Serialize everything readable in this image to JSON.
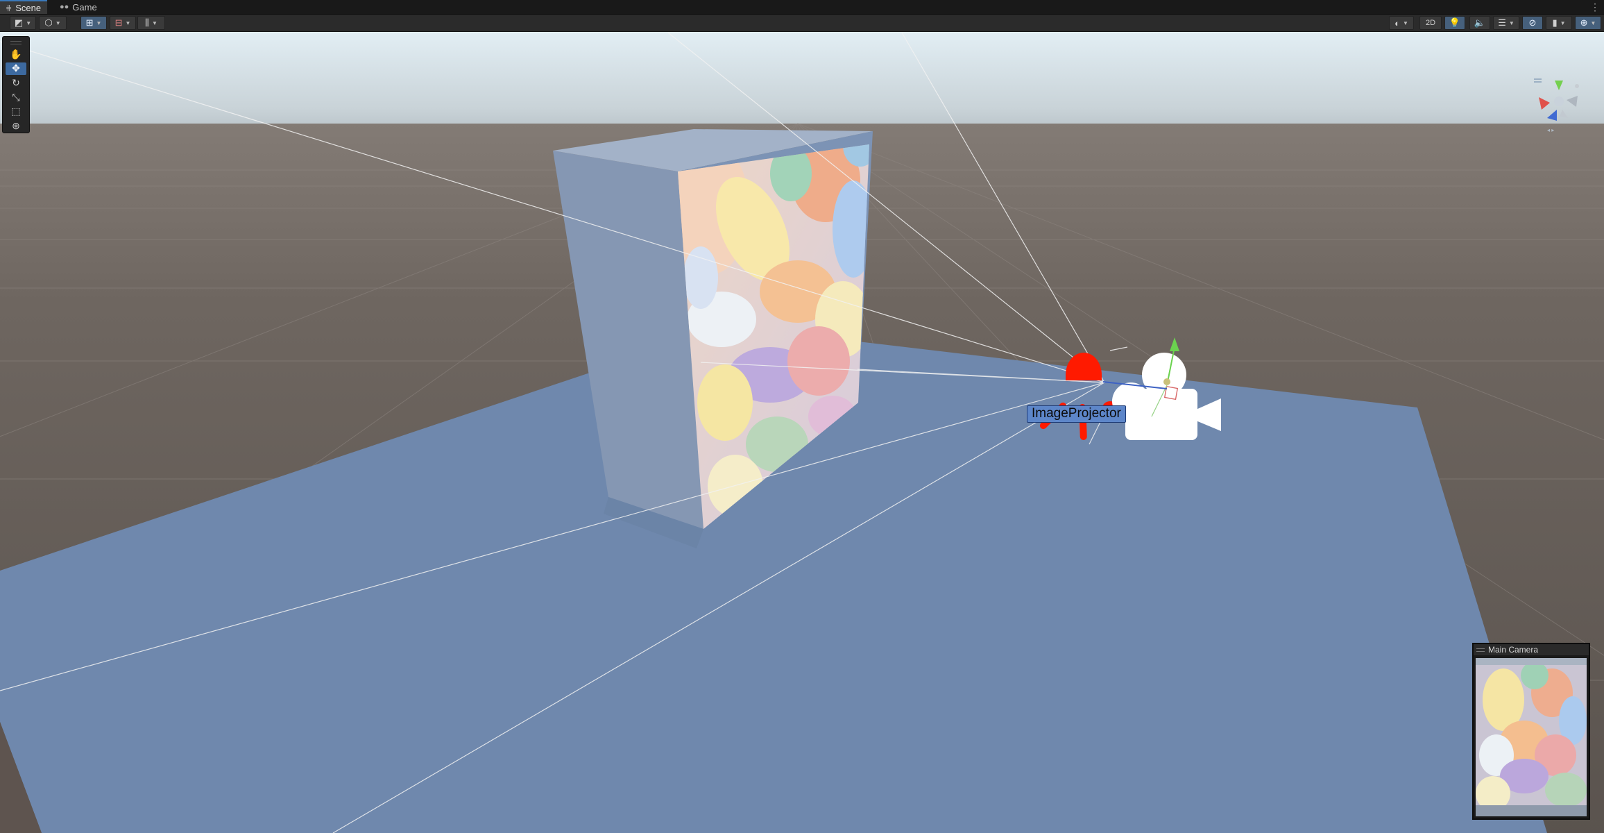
{
  "tabs": [
    {
      "label": "Scene",
      "icon": "grid-icon",
      "active": true
    },
    {
      "label": "Game",
      "icon": "gamepad-icon",
      "active": false
    }
  ],
  "toolbar": {
    "left_buttons": [
      "shading-mode",
      "draw-mode",
      "grid-snapping",
      "increment-snap",
      "align"
    ],
    "right_buttons": [
      "global-lighting",
      "2D",
      "lighting",
      "audio",
      "effects",
      "visibility",
      "camera",
      "gizmos"
    ],
    "mode_2d_label": "2D"
  },
  "tools": [
    "hand-tool",
    "move-tool",
    "rotate-tool",
    "scale-tool",
    "rect-tool",
    "transform-tool"
  ],
  "scene": {
    "selected_object_label": "ImageProjector",
    "colors": {
      "sky_top": "#e2eef4",
      "horizon": "#9ea7ae",
      "ground": "#6a605a",
      "plane": "#6f88ad",
      "box": "#7b92b4",
      "light_gizmo": "#ff1a00",
      "selection": "#5d86c9"
    }
  },
  "camera_preview": {
    "title": "Main Camera"
  }
}
